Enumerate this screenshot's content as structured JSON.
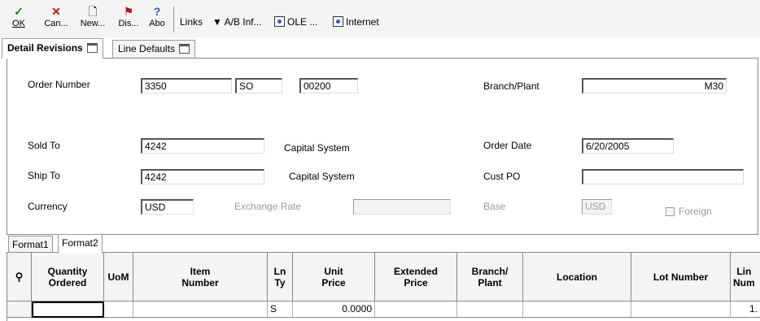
{
  "toolbar": {
    "ok_label": "OK",
    "cancel_label": "Can...",
    "new_label": "New...",
    "display_label": "Dis...",
    "about_label": "Abo",
    "links_label": "Links",
    "ab_info_label": "A/B Inf...",
    "ole_label": "OLE ...",
    "internet_label": "Internet"
  },
  "tabs": {
    "detail": "Detail Revisions",
    "line_defaults": "Line Defaults"
  },
  "form": {
    "order_number_label": "Order Number",
    "order_number": "3350",
    "order_type": "SO",
    "order_company": "00200",
    "branch_plant_label": "Branch/Plant",
    "branch_plant": "M30",
    "sold_to_label": "Sold To",
    "sold_to": "4242",
    "sold_to_name": "Capital System",
    "order_date_label": "Order Date",
    "order_date": "6/20/2005",
    "ship_to_label": "Ship To",
    "ship_to": "4242",
    "ship_to_name": "Capital System",
    "cust_po_label": "Cust PO",
    "cust_po": "",
    "currency_label": "Currency",
    "currency": "USD",
    "exchange_rate_label": "Exchange Rate",
    "exchange_rate": "",
    "base_label": "Base",
    "base": "USD",
    "foreign_label": "Foreign"
  },
  "grid_tabs": {
    "format1": "Format1",
    "format2": "Format2"
  },
  "grid": {
    "headers": {
      "quantity_ordered": "Quantity\nOrdered",
      "uom": "UoM",
      "item_number": "Item\nNumber",
      "ln_ty": "Ln\nTy",
      "unit_price": "Unit\nPrice",
      "extended_price": "Extended\nPrice",
      "branch_plant": "Branch/\nPlant",
      "location": "Location",
      "lot_number": "Lot Number",
      "line_number": "Lin\nNum"
    },
    "row": {
      "quantity_ordered": "",
      "uom": "",
      "item_number": "",
      "ln_ty": "S",
      "unit_price": "0.0000",
      "extended_price": "",
      "branch_plant": "",
      "location": "",
      "lot_number": "",
      "line_number": "1."
    }
  }
}
